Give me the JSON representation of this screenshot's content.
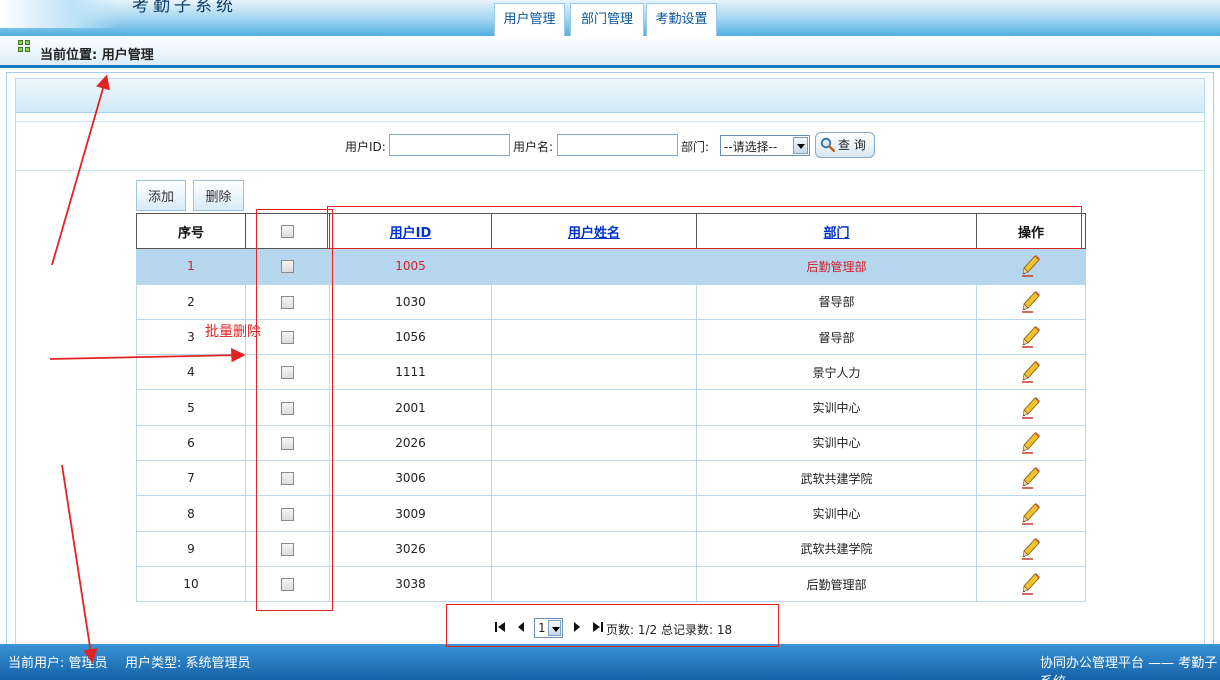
{
  "header": {
    "system_title": "考勤子系统",
    "tabs": [
      {
        "label": "用户管理"
      },
      {
        "label": "部门管理"
      },
      {
        "label": "考勤设置"
      }
    ]
  },
  "location": {
    "text": "当前位置: 用户管理"
  },
  "search": {
    "user_id_label": "用户ID:",
    "user_id_value": "",
    "user_name_label": "用户名:",
    "user_name_value": "",
    "dept_label": "部门:",
    "dept_selected": "--请选择--",
    "query_label": "查 询"
  },
  "toolbar": {
    "add_label": "添加",
    "delete_label": "删除"
  },
  "table": {
    "headers": [
      "序号",
      "",
      "用户ID",
      "用户姓名",
      "部门",
      "操作"
    ],
    "rows": [
      {
        "index": "1",
        "user_id": "1005",
        "name": "",
        "dept": "后勤管理部"
      },
      {
        "index": "2",
        "user_id": "1030",
        "name": "",
        "dept": "督导部"
      },
      {
        "index": "3",
        "user_id": "1056",
        "name": "",
        "dept": "督导部"
      },
      {
        "index": "4",
        "user_id": "1111",
        "name": "",
        "dept": "景宁人力"
      },
      {
        "index": "5",
        "user_id": "2001",
        "name": "",
        "dept": "实训中心"
      },
      {
        "index": "6",
        "user_id": "2026",
        "name": "",
        "dept": "实训中心"
      },
      {
        "index": "7",
        "user_id": "3006",
        "name": "",
        "dept": "武软共建学院"
      },
      {
        "index": "8",
        "user_id": "3009",
        "name": "",
        "dept": "实训中心"
      },
      {
        "index": "9",
        "user_id": "3026",
        "name": "",
        "dept": "武软共建学院"
      },
      {
        "index": "10",
        "user_id": "3038",
        "name": "",
        "dept": "后勤管理部"
      }
    ],
    "selected_row": 1,
    "edit_icon": "pencil-icon"
  },
  "pagination": {
    "first_icon": "first-page-icon",
    "prev_icon": "prev-page-icon",
    "current_page": "1",
    "next_icon": "next-page-icon",
    "last_icon": "last-page-icon",
    "summary": "页数: 1/2 总记录数: 18"
  },
  "annotation": {
    "batch_delete_label": "批量删除",
    "color": "#e32222"
  },
  "status_bar": {
    "current_user": "当前用户: 管理员",
    "user_type": "用户类型: 系统管理员",
    "platform": "协同办公管理平台 —— 考勤子系统"
  },
  "colors": {
    "header_blue": "#52aee0",
    "status_blue": "#1561a8",
    "selected_row": "#b6d6ed",
    "selected_text": "#d0202a",
    "link": "#0033cc"
  }
}
